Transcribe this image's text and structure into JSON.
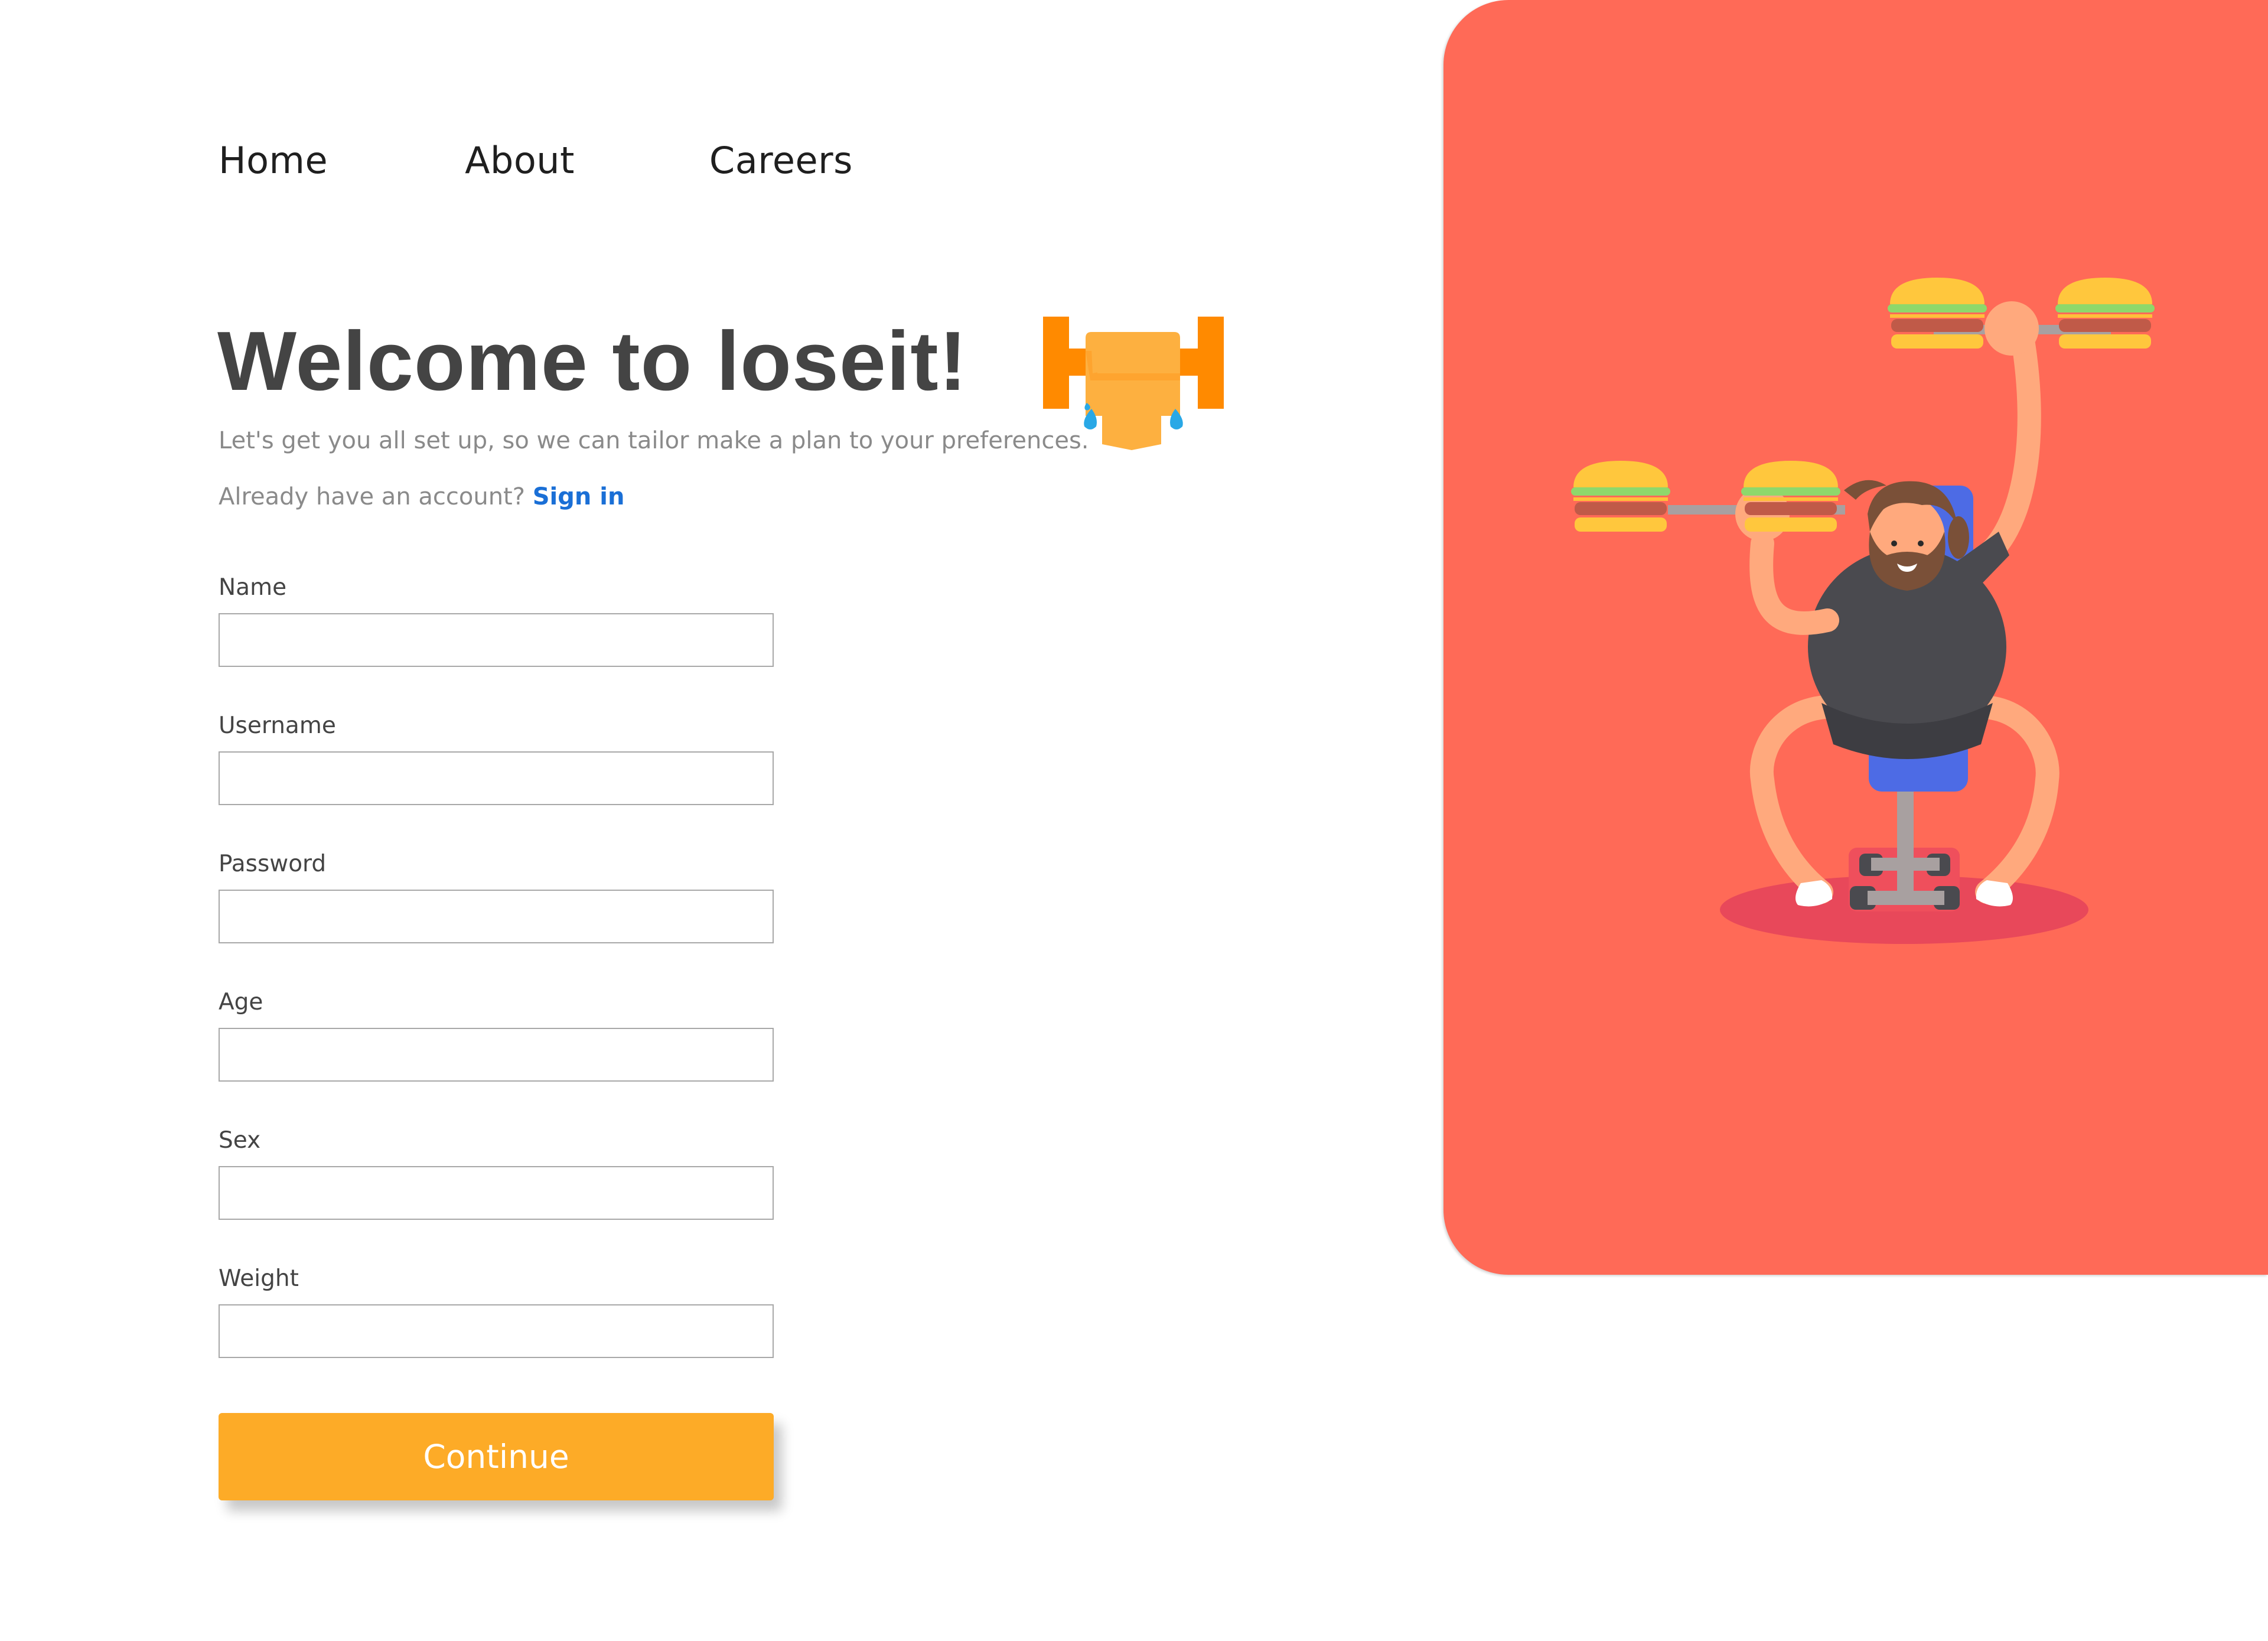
{
  "nav": {
    "items": [
      "Home",
      "About",
      "Careers"
    ]
  },
  "hero": {
    "title": "Welcome to loseit!",
    "subtitle": "Let's get you all set up, so we can tailor make a plan to your preferences.",
    "account_prompt": "Already have an account?",
    "sign_in_label": "Sign in"
  },
  "form": {
    "fields": [
      {
        "label": "Name",
        "value": ""
      },
      {
        "label": "Username",
        "value": ""
      },
      {
        "label": "Password",
        "value": ""
      },
      {
        "label": "Age",
        "value": ""
      },
      {
        "label": "Sex",
        "value": ""
      },
      {
        "label": "Weight",
        "value": ""
      }
    ],
    "submit_label": "Continue"
  },
  "icons": {
    "logo": "weightlifting-icon",
    "illustration": "burger-lifting-man-illustration"
  },
  "colors": {
    "accent": "#fdab27",
    "panel": "#ff6a57",
    "link": "#1a6fd6",
    "title": "#444444"
  }
}
